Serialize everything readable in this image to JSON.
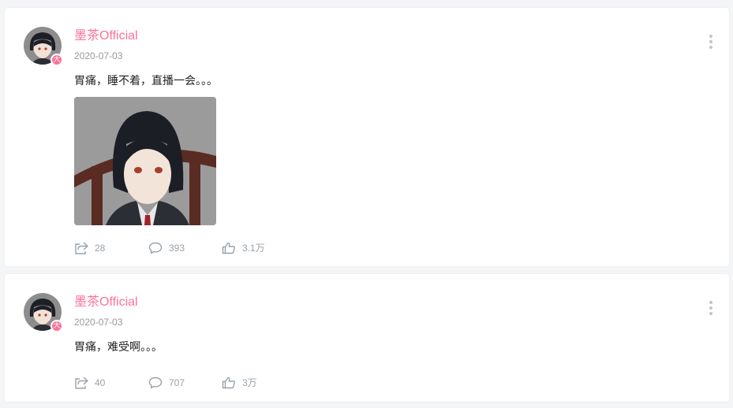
{
  "posts": [
    {
      "username": "墨茶Official",
      "date": "2020-07-03",
      "text": "胃痛，睡不着，直播一会。。。",
      "has_image": true,
      "stats": {
        "forward": "28",
        "comment": "393",
        "like": "3.1万"
      }
    },
    {
      "username": "墨茶Official",
      "date": "2020-07-03",
      "text": "胃痛，难受啊。。。",
      "has_image": false,
      "stats": {
        "forward": "40",
        "comment": "707",
        "like": "3万"
      }
    }
  ],
  "avatar_badge": "大",
  "icons": {
    "forward": "share-icon",
    "comment": "comment-icon",
    "like": "thumbs-up-icon",
    "more": "more-vertical-icon"
  },
  "colors": {
    "accent": "#fb7299",
    "text": "#212121",
    "muted": "#999999",
    "icon": "#99a2aa",
    "background": "#f4f5f7"
  }
}
